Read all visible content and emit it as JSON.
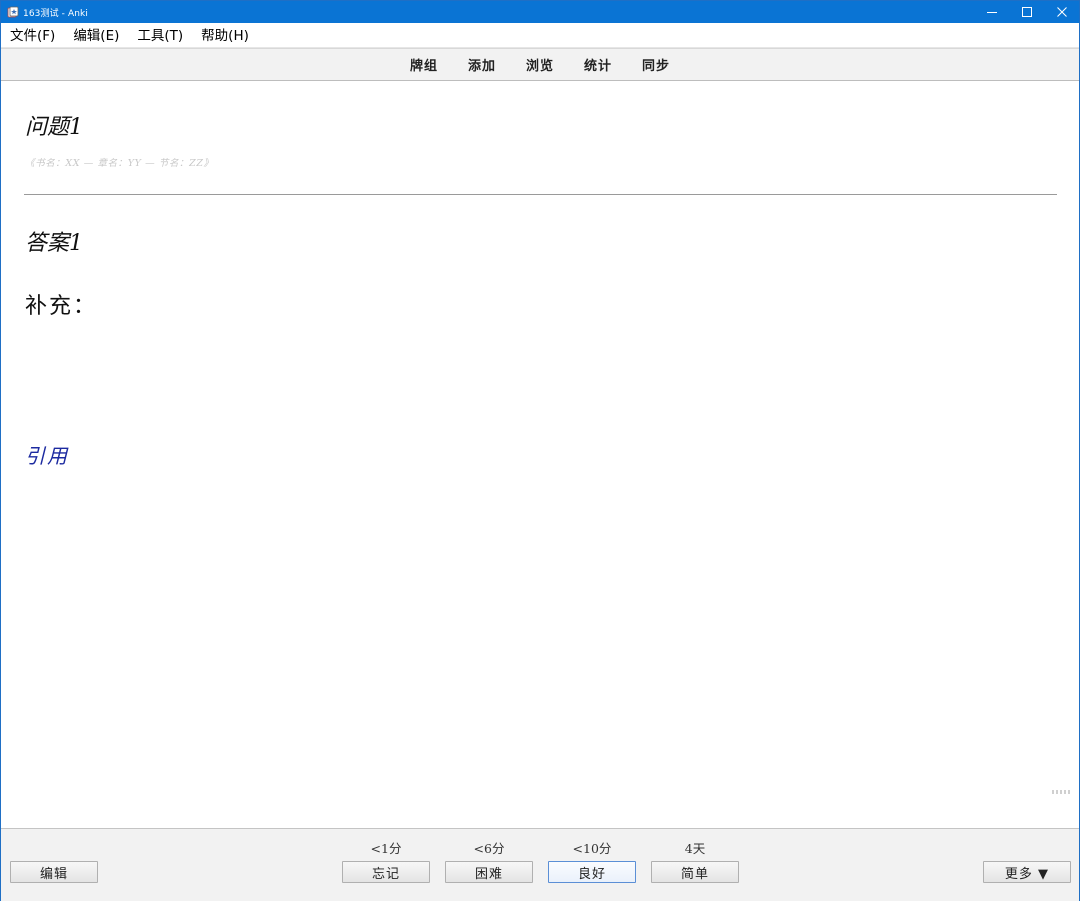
{
  "window": {
    "title": "163测试 - Anki",
    "controls": [
      "minimize-icon",
      "maximize-icon",
      "close-icon"
    ]
  },
  "menu": {
    "items": [
      "文件(F)",
      "编辑(E)",
      "工具(T)",
      "帮助(H)"
    ]
  },
  "toolbar": {
    "links": [
      "牌组",
      "添加",
      "浏览",
      "统计",
      "同步"
    ]
  },
  "card": {
    "question": "问题1",
    "source": "《书名：XX — 章名：YY — 节名：ZZ》",
    "answer": "答案1",
    "supplement": "补充：",
    "reference": "引用",
    "reference_color": "#1c2aa0"
  },
  "bottombar": {
    "edit_label": "编辑",
    "more_label": "更多 ▼",
    "answers": [
      {
        "interval": "<1分",
        "label": "忘记"
      },
      {
        "interval": "<6分",
        "label": "困难"
      },
      {
        "interval": "<10分",
        "label": "良好"
      },
      {
        "interval": "4天",
        "label": "简单"
      }
    ]
  },
  "colors": {
    "titlebar": "#0a74d4",
    "focus_border": "#5b8fd6"
  }
}
